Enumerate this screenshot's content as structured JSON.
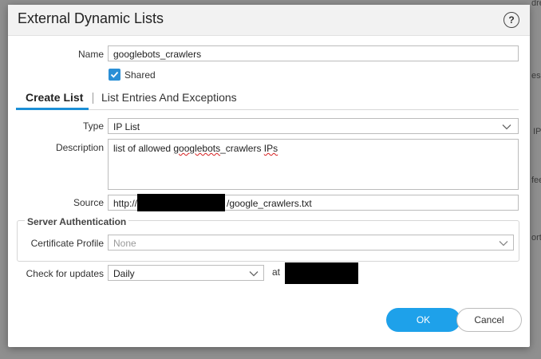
{
  "background": {
    "fragments": [
      "dre",
      "ess",
      "IP",
      "fee",
      "ort"
    ]
  },
  "dialog": {
    "title": "External Dynamic Lists",
    "help_icon": "help-icon"
  },
  "form": {
    "name_label": "Name",
    "name_value": "googlebots_crawlers",
    "shared_label": "Shared",
    "shared_checked": true,
    "tabs": [
      {
        "label": "Create List",
        "active": true
      },
      {
        "label": "List Entries And Exceptions",
        "active": false
      }
    ],
    "type_label": "Type",
    "type_value": "IP List",
    "description_label": "Description",
    "description_value_prefix": "list of allowed ",
    "description_value_misspelled": "googlebots",
    "description_value_mid": "_crawlers ",
    "description_value_misspelled2": "IPs",
    "source_label": "Source",
    "source_prefix": "http://",
    "source_suffix": "/google_crawlers.txt",
    "server_auth_title": "Server Authentication",
    "cert_profile_label": "Certificate Profile",
    "cert_profile_value": "None",
    "check_updates_label": "Check for updates",
    "check_updates_value": "Daily",
    "at_label": "at"
  },
  "buttons": {
    "ok": "OK",
    "cancel": "Cancel"
  },
  "colors": {
    "accent": "#1ea1ea",
    "checkbox": "#2a8fd6"
  }
}
